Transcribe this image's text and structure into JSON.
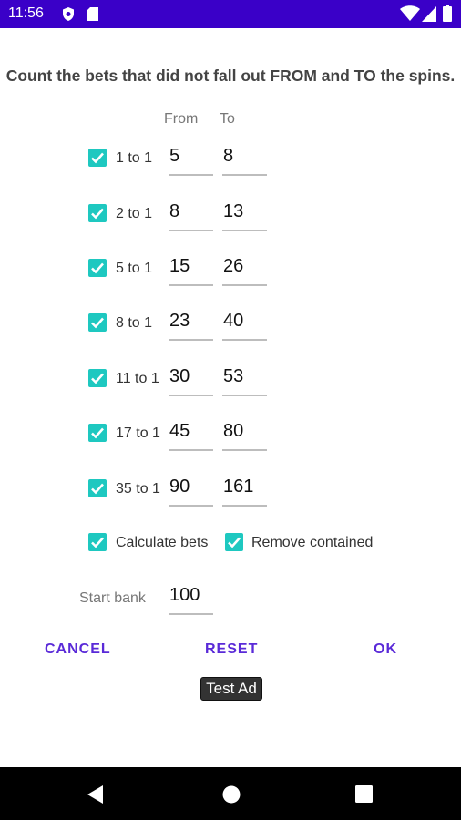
{
  "status_bar": {
    "time": "11:56",
    "icons": [
      "shield-icon",
      "sd-card-icon",
      "wifi-icon",
      "signal-icon",
      "battery-icon"
    ]
  },
  "dialog": {
    "title": "Count the bets that did not fall out FROM and TO the spins.",
    "column_from": "From",
    "column_to": "To",
    "bets": [
      {
        "label": "1 to 1",
        "checked": true,
        "from": "5",
        "to": "8"
      },
      {
        "label": "2 to 1",
        "checked": true,
        "from": "8",
        "to": "13"
      },
      {
        "label": "5 to 1",
        "checked": true,
        "from": "15",
        "to": "26"
      },
      {
        "label": "8 to 1",
        "checked": true,
        "from": "23",
        "to": "40"
      },
      {
        "label": "11 to 1",
        "checked": true,
        "from": "30",
        "to": "53"
      },
      {
        "label": "17 to 1",
        "checked": true,
        "from": "45",
        "to": "80"
      },
      {
        "label": "35 to 1",
        "checked": true,
        "from": "90",
        "to": "161"
      }
    ],
    "calculate_bets": {
      "label": "Calculate bets",
      "checked": true
    },
    "remove_contained": {
      "label": "Remove contained",
      "checked": true
    },
    "start_bank": {
      "label": "Start bank",
      "value": "100"
    },
    "buttons": {
      "cancel": "CANCEL",
      "reset": "RESET",
      "ok": "OK"
    }
  },
  "ad_label": "Test Ad",
  "colors": {
    "status_bar": "#3a00c8",
    "accent": "#1ec8c0",
    "button_text": "#5a2ad8",
    "nav_bar": "#000000"
  }
}
